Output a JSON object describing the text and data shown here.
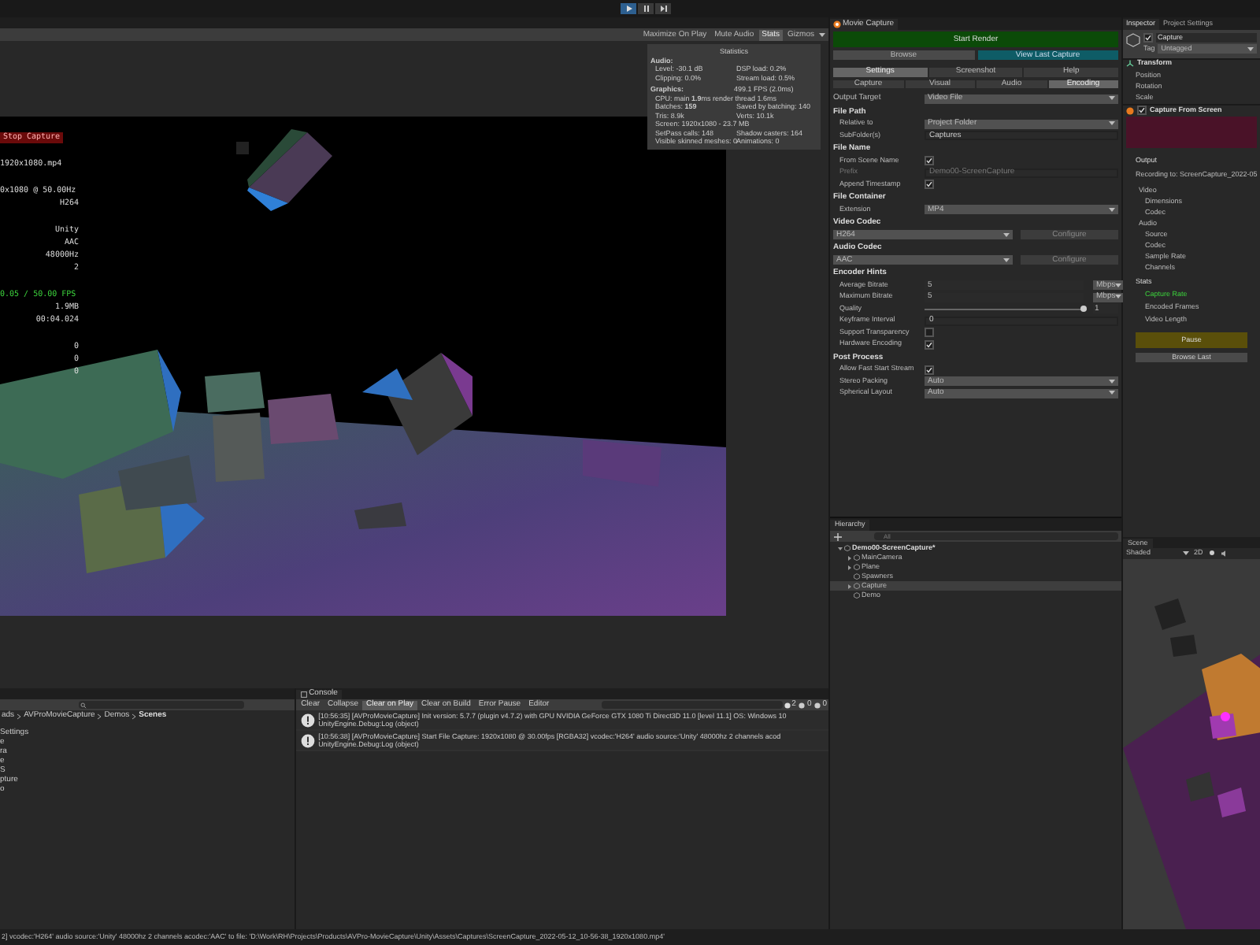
{
  "toolbar": {
    "play_buttons": [
      {
        "kind": "play",
        "selected": true
      },
      {
        "kind": "pause",
        "selected": false
      },
      {
        "kind": "step",
        "selected": false
      }
    ]
  },
  "game_view": {
    "options": [
      {
        "label": "Maximize On Play",
        "selected": false
      },
      {
        "label": "Mute Audio",
        "selected": false
      },
      {
        "label": "Stats",
        "selected": true
      },
      {
        "label": "Gizmos",
        "selected": false
      }
    ],
    "overlay": {
      "button": "Stop Capture",
      "groups": [
        [
          {
            "text": "1920x1080.mp4",
            "kind": "left"
          }
        ],
        [
          {
            "text": "0x1080 @ 50.00Hz",
            "kind": "left"
          },
          {
            "text": "H264",
            "kind": "right"
          }
        ],
        [
          {
            "text": "Unity",
            "kind": "right"
          },
          {
            "text": "AAC",
            "kind": "right"
          },
          {
            "text": "48000Hz",
            "kind": "right"
          },
          {
            "text": "2",
            "kind": "right"
          }
        ],
        [
          {
            "text": "0.05 / 50.00 FPS",
            "kind": "green"
          },
          {
            "text": "1.9MB",
            "kind": "right"
          },
          {
            "text": "00:04.024",
            "kind": "right"
          }
        ],
        [
          {
            "text": "0",
            "kind": "right"
          },
          {
            "text": "0",
            "kind": "right"
          },
          {
            "text": "0",
            "kind": "right"
          }
        ]
      ]
    },
    "statistics": {
      "title": "Statistics",
      "audio_heading": "Audio:",
      "audio_rows": [
        [
          "Level: -30.1 dB",
          "DSP load: 0.2%"
        ],
        [
          "Clipping: 0.0%",
          "Stream load: 0.5%"
        ]
      ],
      "graphics_heading": "Graphics:",
      "fps": "499.1 FPS (2.0ms)",
      "graphics_rows": [
        [
          "CPU: main **1.9**ms  render thread 1.6ms"
        ],
        [
          "Batches: **159**",
          "Saved by batching: 140"
        ],
        [
          "Tris: 8.9k",
          "Verts: 10.1k"
        ],
        [
          "Screen: 1920x1080 - 23.7 MB"
        ],
        [
          "SetPass calls: 148",
          "Shadow casters: 164"
        ],
        [
          "Visible skinned meshes: 0",
          "Animations: 0"
        ]
      ]
    }
  },
  "project": {
    "breadcrumb": [
      "ads",
      "AVProMovieCapture",
      "Demos",
      "Scenes"
    ],
    "items": [
      "Settings",
      "e",
      "ra",
      "e",
      "S",
      "pture",
      "o"
    ]
  },
  "console": {
    "title": "Console",
    "buttons": [
      {
        "label": "Clear",
        "selected": false
      },
      {
        "label": "Collapse",
        "selected": false
      },
      {
        "label": "Clear on Play",
        "selected": true
      },
      {
        "label": "Clear on Build",
        "selected": false
      },
      {
        "label": "Error Pause",
        "selected": false
      },
      {
        "label": "Editor",
        "selected": false
      }
    ],
    "counts": {
      "info": "2",
      "warning": "0",
      "error": "0"
    },
    "messages": [
      {
        "line1": "[10:56:35] [AVProMovieCapture] Init version: 5.7.7 (plugin v4.7.2) with GPU NVIDIA GeForce GTX 1080 Ti Direct3D 11.0 [level 11.1] OS: Windows 10",
        "line2": "UnityEngine.Debug:Log (object)"
      },
      {
        "line1": "[10:56:38] [AVProMovieCapture] Start File Capture: 1920x1080 @ 30.00fps [RGBA32] vcodec:'H264' audio source:'Unity' 48000hz 2 channels acod",
        "line2": "UnityEngine.Debug:Log (object)"
      }
    ]
  },
  "movie_capture": {
    "title": "Movie Capture",
    "start_button": "Start Render",
    "browse_button": "Browse",
    "view_button": "View Last Capture",
    "tabs": [
      {
        "label": "Settings",
        "selected": true
      },
      {
        "label": "Screenshot",
        "selected": false
      },
      {
        "label": "Help",
        "selected": false
      }
    ],
    "subtabs": [
      {
        "label": "Capture",
        "selected": false
      },
      {
        "label": "Visual",
        "selected": false
      },
      {
        "label": "Audio",
        "selected": false
      },
      {
        "label": "Encoding",
        "selected": true
      }
    ],
    "rows": [
      {
        "kind": "dropdown",
        "label": "Output Target",
        "value": "Video File",
        "indent": false
      },
      {
        "kind": "header",
        "label": "File Path"
      },
      {
        "kind": "dropdown",
        "label": "Relative to",
        "value": "Project Folder",
        "indent": true
      },
      {
        "kind": "text",
        "label": "SubFolder(s)",
        "value": "Captures",
        "disabled": false
      },
      {
        "kind": "header",
        "label": "File Name"
      },
      {
        "kind": "checkbox",
        "label": "From Scene Name",
        "checked": true
      },
      {
        "kind": "text",
        "label": "Prefix",
        "value": "Demo00-ScreenCapture",
        "disabled": true
      },
      {
        "kind": "checkbox",
        "label": "Append Timestamp",
        "checked": true
      },
      {
        "kind": "header",
        "label": "File Container"
      },
      {
        "kind": "dropdown",
        "label": "Extension",
        "value": "MP4",
        "indent": true
      },
      {
        "kind": "header",
        "label": "Video Codec"
      },
      {
        "kind": "codec",
        "value": "H264",
        "button": "Configure"
      },
      {
        "kind": "header",
        "label": "Audio Codec"
      },
      {
        "kind": "codec",
        "value": "AAC",
        "button": "Configure"
      },
      {
        "kind": "header",
        "label": "Encoder Hints"
      },
      {
        "kind": "unit",
        "label": "Average Bitrate",
        "value": "5",
        "unit": "Mbps"
      },
      {
        "kind": "unit",
        "label": "Maximum Bitrate",
        "value": "5",
        "unit": "Mbps"
      },
      {
        "kind": "slider",
        "label": "Quality",
        "level": 1,
        "reading": "1"
      },
      {
        "kind": "text",
        "label": "Keyframe Interval",
        "value": "0",
        "disabled": false
      },
      {
        "kind": "checkbox",
        "label": "Support Transparency",
        "checked": false
      },
      {
        "kind": "checkbox",
        "label": "Hardware Encoding",
        "checked": true
      },
      {
        "kind": "header",
        "label": "Post Process"
      },
      {
        "kind": "checkbox",
        "label": "Allow Fast Start Stream",
        "checked": true
      },
      {
        "kind": "dropdown",
        "label": "Stereo Packing",
        "value": "Auto",
        "indent": true
      },
      {
        "kind": "dropdown",
        "label": "Spherical Layout",
        "value": "Auto",
        "indent": true
      }
    ]
  },
  "hierarchy": {
    "title": "Hierarchy",
    "search_placeholder": "All",
    "tree": [
      {
        "label": "Demo00-ScreenCapture*",
        "expanded": true,
        "selected": false,
        "children": [
          {
            "label": "MainCamera",
            "expanded": false,
            "selected": false
          },
          {
            "label": "Plane",
            "expanded": false,
            "selected": false
          },
          {
            "label": "Spawners",
            "selected": false
          },
          {
            "label": "Capture",
            "expanded": false,
            "selected": true
          },
          {
            "label": "Demo",
            "selected": false
          }
        ]
      }
    ]
  },
  "inspector": {
    "tabs": [
      {
        "label": "Inspector",
        "selected": true
      },
      {
        "label": "Project Settings",
        "selected": false
      }
    ],
    "object": {
      "name": "Capture",
      "active": true,
      "tag_label": "Tag",
      "tag": "Untagged"
    },
    "transform": {
      "title": "Transform",
      "fields": [
        "Position",
        "Rotation",
        "Scale"
      ]
    },
    "component": {
      "title": "Capture From Screen",
      "enabled": true,
      "output_heading": "Output",
      "recording": "Recording to: ScreenCapture_2022-05",
      "info": [
        {
          "text": "Video",
          "indent": false
        },
        {
          "text": "Dimensions",
          "indent": true
        },
        {
          "text": "Codec",
          "indent": true
        },
        {
          "text": "Audio",
          "indent": false
        },
        {
          "text": "Source",
          "indent": true
        },
        {
          "text": "Codec",
          "indent": true
        },
        {
          "text": "Sample Rate",
          "indent": true
        },
        {
          "text": "Channels",
          "indent": true
        }
      ],
      "stats_heading": "Stats",
      "stats": [
        {
          "text": "Capture Rate",
          "kind": "highlight"
        },
        {
          "text": "Encoded Frames",
          "kind": "normal"
        },
        {
          "text": "Video Length",
          "kind": "normal"
        }
      ],
      "pause_button": "Pause",
      "browse_button": "Browse Last"
    }
  },
  "scene": {
    "title": "Scene",
    "shading": "Shaded",
    "mode": "2D"
  },
  "status_bar": "2] vcodec:'H264' audio source:'Unity' 48000hz 2 channels acodec:'AAC' to file: 'D:\\Work\\RH\\Projects\\Products\\AVPro-MovieCapture\\Unity\\Assets\\Captures\\ScreenCapture_2022-05-12_10-56-38_1920x1080.mp4'"
}
